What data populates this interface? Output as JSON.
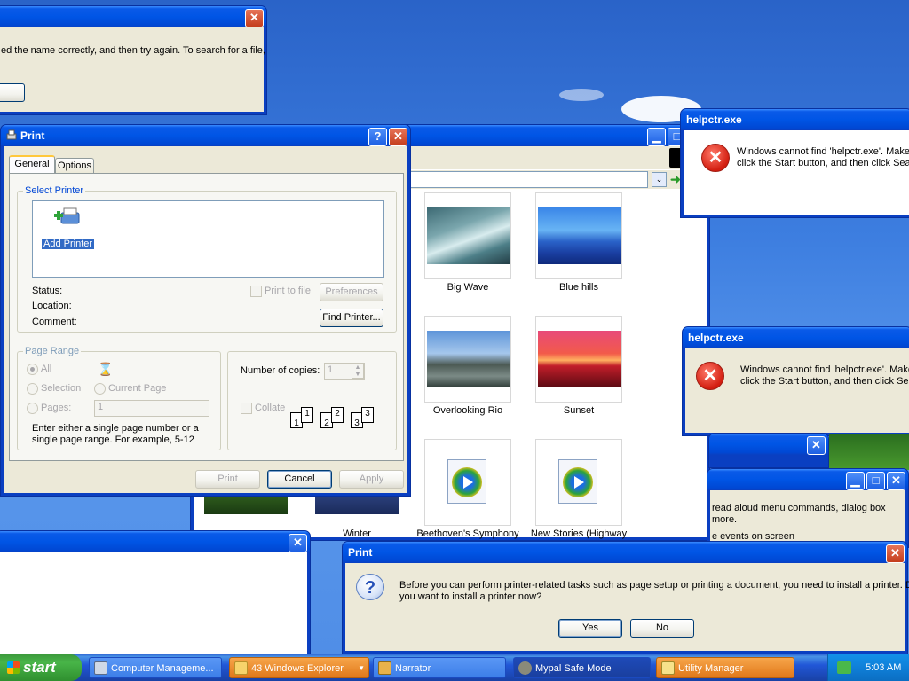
{
  "search_dialog": {
    "text": "ed the name correctly, and then try again. To search for a file,"
  },
  "print_dialog": {
    "title": "Print",
    "tabs": [
      "General",
      "Options"
    ],
    "select_printer_legend": "Select Printer",
    "add_printer_label": "Add Printer",
    "status_label": "Status:",
    "location_label": "Location:",
    "comment_label": "Comment:",
    "print_to_file_label": "Print to file",
    "preferences_label": "Preferences",
    "find_printer_label": "Find Printer...",
    "page_range_legend": "Page Range",
    "all_label": "All",
    "selection_label": "Selection",
    "current_page_label": "Current Page",
    "pages_label": "Pages:",
    "pages_value": "1",
    "page_range_help": "Enter either a single page number or a single page range.  For example, 5-12",
    "copies_label": "Number of copies:",
    "copies_value": "1",
    "collate_label": "Collate",
    "collate_pages": [
      "1",
      "1",
      "2",
      "2",
      "3",
      "3"
    ],
    "print_button": "Print",
    "cancel_button": "Cancel",
    "apply_button": "Apply"
  },
  "explorer": {
    "go_label": "Go",
    "items": [
      {
        "caption": "Big Wave"
      },
      {
        "caption": "Blue hills"
      },
      {
        "caption": "Overlooking Rio"
      },
      {
        "caption": "Sunset"
      },
      {
        "caption": "Beethoven's Symphony"
      },
      {
        "caption": "New Stories (Highway"
      },
      {
        "caption": "Winter"
      }
    ]
  },
  "helpctr_1": {
    "title": "helpctr.exe",
    "line1": "Windows cannot find 'helpctr.exe'. Make",
    "line2": "click the Start button, and then click Sear"
  },
  "helpctr_2": {
    "title": "helpctr.exe",
    "line1": "Windows cannot find 'helpctr.exe'. Make",
    "line2": "click the Start button, and then click Sea"
  },
  "narrator_window": {
    "line1": "read aloud menu commands, dialog box",
    "line2": "more.",
    "line3": "e events on screen"
  },
  "print_prompt": {
    "title": "Print",
    "message_line1": "Before you can perform printer-related tasks such as page setup or printing a document, you need to install a printer. Do",
    "message_line2": "you want to install a printer now?",
    "yes_button": "Yes",
    "no_button": "No"
  },
  "taskbar": {
    "start_label": "start",
    "items": [
      {
        "label": "Computer Manageme..."
      },
      {
        "label": "43 Windows Explorer"
      },
      {
        "label": "Narrator"
      },
      {
        "label": "Mypal Safe Mode"
      },
      {
        "label": "Utility Manager"
      }
    ],
    "clock": "5:03 AM"
  }
}
